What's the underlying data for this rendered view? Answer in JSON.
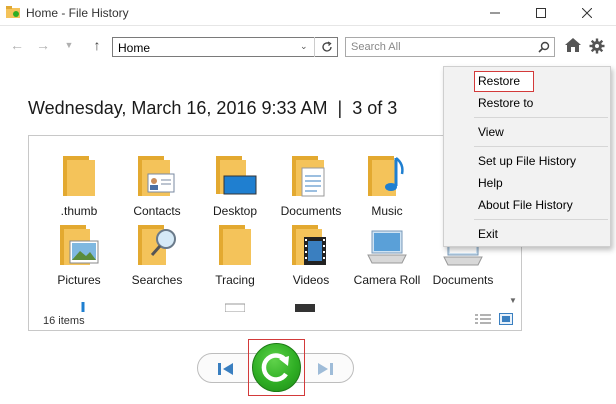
{
  "window": {
    "title": "Home - File History",
    "minimize_icon": "minimize-icon",
    "maximize_icon": "maximize-icon",
    "close_icon": "close-icon"
  },
  "toolbar": {
    "address": "Home",
    "search_placeholder": "Search All",
    "icons": [
      "back-arrow-icon",
      "forward-arrow-icon",
      "recent-dropdown-icon",
      "up-arrow-icon",
      "refresh-icon",
      "search-icon",
      "home-icon",
      "gear-icon"
    ]
  },
  "heading": {
    "date": "Wednesday, March 16, 2016 9:33 AM",
    "separator": "|",
    "position": "3 of 3"
  },
  "items": [
    {
      "label": "",
      "icon": "folder-icon"
    },
    {
      "label": ".thumb",
      "icon": "folder-icon"
    },
    {
      "label": "Contacts",
      "icon": "contacts-folder-icon"
    },
    {
      "label": "Desktop",
      "icon": "desktop-folder-icon"
    },
    {
      "label": "Documents",
      "icon": "documents-folder-icon"
    },
    {
      "label": "Music",
      "icon": "music-folder-icon"
    },
    {
      "label": "Pictures",
      "icon": "pictures-folder-icon"
    },
    {
      "label": "Searches",
      "icon": "searches-folder-icon"
    },
    {
      "label": "Tracing",
      "icon": "folder-icon"
    },
    {
      "label": "Videos",
      "icon": "videos-folder-icon"
    },
    {
      "label": "Camera Roll",
      "icon": "camera-roll-icon"
    },
    {
      "label": "Documents",
      "icon": "documents-library-icon"
    }
  ],
  "status": {
    "count": "16 items"
  },
  "context_menu": {
    "items": [
      "Restore",
      "Restore to",
      "View",
      "Set up File History",
      "Help",
      "About File History",
      "Exit"
    ]
  },
  "colors": {
    "folder": "#f4c35a",
    "highlight_frame": "#d33a3a",
    "restore_green": "#2fae24",
    "nav_blue": "#3a7fc0"
  }
}
